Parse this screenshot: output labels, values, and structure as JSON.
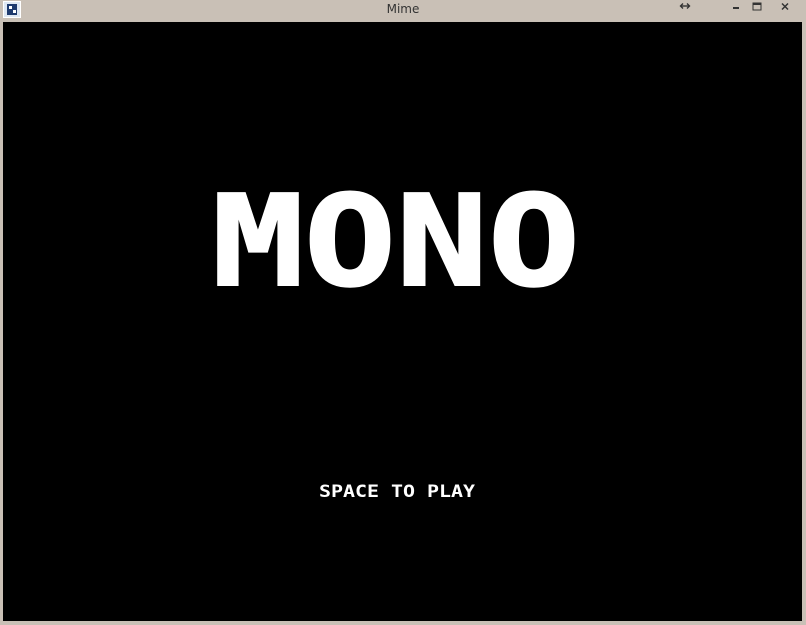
{
  "window": {
    "title": "Mime",
    "icon": "app-icon",
    "controls": [
      "resize-icon",
      "minimize-icon",
      "maximize-icon",
      "close-icon"
    ]
  },
  "game": {
    "logo_text": "MONO",
    "prompt": "SPACE TO PLAY",
    "colors": {
      "background": "#000000",
      "foreground": "#ffffff",
      "window_frame": "#c9c0b6"
    }
  }
}
